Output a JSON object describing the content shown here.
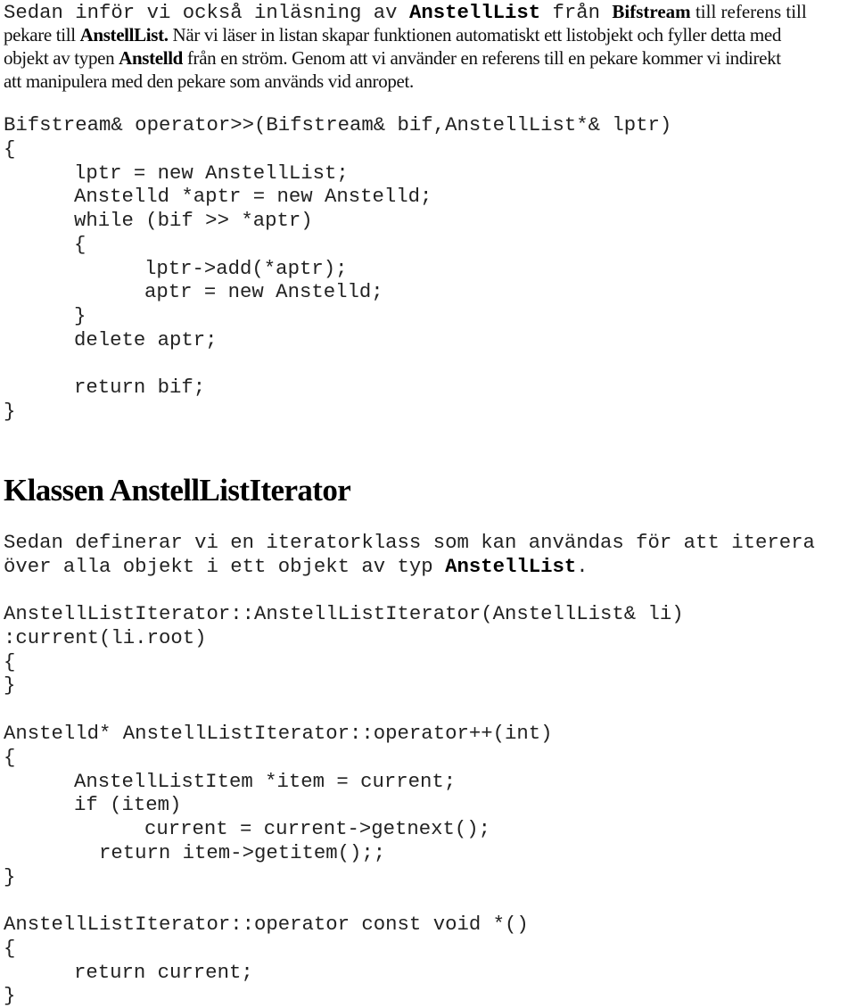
{
  "intro": {
    "line1_mono": "Sedan inför vi också inläsning av ",
    "line1_bold_mono": "AnstellList",
    "line1_mono_2": " från ",
    "line1_bold_serif": "Bifstream",
    "line1_serif": " till referens till",
    "line2_serif": "pekare till ",
    "line2_bold": "AnstellList.",
    "line2_serif_2": " När vi läser in listan skapar funktionen automatiskt ett listobjekt och fyller detta med",
    "line3_serif": "objekt av typen ",
    "line3_bold": "Anstelld",
    "line3_serif_2": " från en ström. Genom att vi använder en referens till en pekare kommer vi indirekt",
    "line4_serif": "att manipulera med den pekare som används vid anropet."
  },
  "code_block_1": [
    "Bifstream& operator>>(Bifstream& bif,AnstellList*& lptr)",
    "{",
    "lptr = new AnstellList;",
    "Anstelld *aptr = new Anstelld;",
    "while (bif >> *aptr)",
    "{",
    "lptr->add(*aptr);",
    "aptr = new Anstelld;",
    "}",
    "delete aptr;",
    "return bif;",
    "}"
  ],
  "section": {
    "heading": "Klassen AnstellListIterator",
    "para_line1": "Sedan definerar vi en iteratorklass som kan användas för att iterera",
    "para_line2": "över alla objekt i ett objekt av typ ",
    "para_line2_bold": "AnstellList",
    "para_line2_end": "."
  },
  "code_block_2": [
    "AnstellListIterator::AnstellListIterator(AnstellList& li)",
    ":current(li.root)",
    "{",
    "}"
  ],
  "code_block_3": [
    "Anstelld* AnstellListIterator::operator++(int)",
    "{",
    "AnstellListItem *item = current;",
    "if (item)",
    "current = current->getnext();",
    "return item->getitem();;",
    "}"
  ],
  "code_block_4": [
    "AnstellListIterator::operator const void *()",
    "{",
    "return current;",
    "}"
  ]
}
